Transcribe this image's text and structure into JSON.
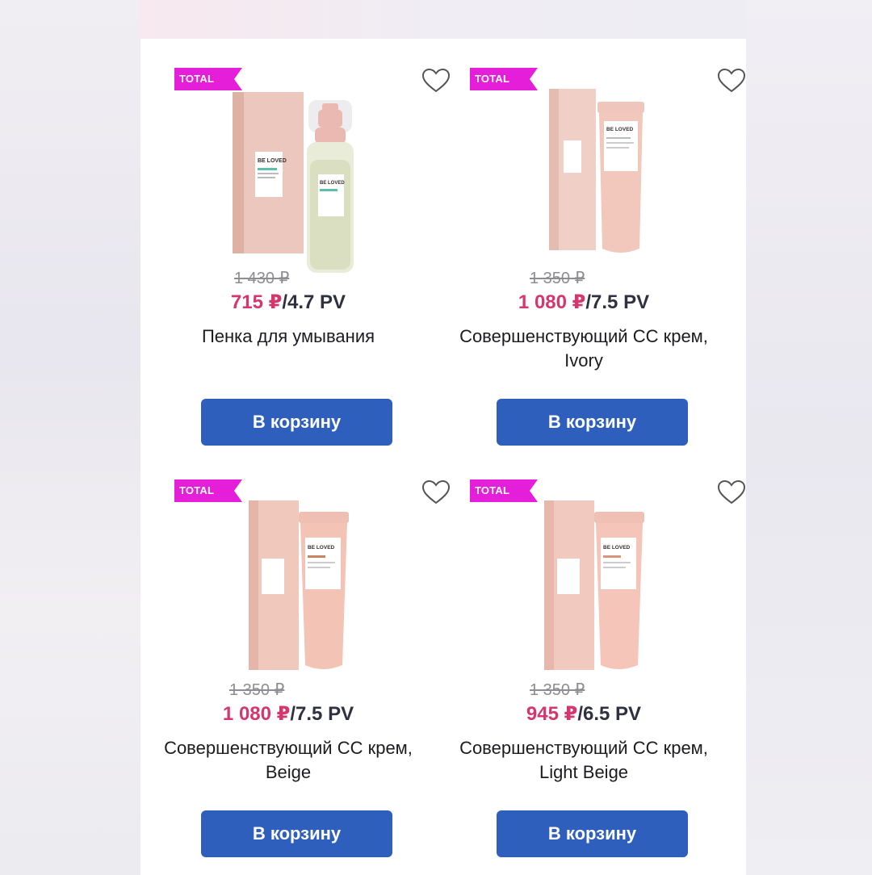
{
  "colors": {
    "badge": "#e41ed9",
    "price_accent": "#d4366e",
    "button": "#2e5fbd",
    "panel": "#ffffff"
  },
  "products": [
    {
      "badge": "TOTAL SALE",
      "old_price": "1 430 ₽",
      "price": "715 ₽",
      "separator": "/",
      "pv": "4.7 PV",
      "title": "Пенка для умывания",
      "button": "В корзину",
      "icons": {
        "favorite": "heart-outline-icon"
      }
    },
    {
      "badge": "TOTAL SALE",
      "old_price": "1 350 ₽",
      "price": "1 080 ₽",
      "separator": "/",
      "pv": "7.5 PV",
      "title": "Совершенствующий СС крем, Ivory",
      "button": "В корзину",
      "icons": {
        "favorite": "heart-outline-icon"
      }
    },
    {
      "badge": "TOTAL SALE",
      "old_price": "1 350 ₽",
      "price": "1 080 ₽",
      "separator": "/",
      "pv": "7.5 PV",
      "title": "Совершенствующий СС крем, Beige",
      "button": "В корзину",
      "icons": {
        "favorite": "heart-outline-icon"
      }
    },
    {
      "badge": "TOTAL SALE",
      "old_price": "1 350 ₽",
      "price": "945 ₽",
      "separator": "/",
      "pv": "6.5 PV",
      "title": "Совершенствующий СС крем, Light Beige",
      "button": "В корзину",
      "icons": {
        "favorite": "heart-outline-icon"
      }
    }
  ],
  "brand_print": "BE LOVED"
}
